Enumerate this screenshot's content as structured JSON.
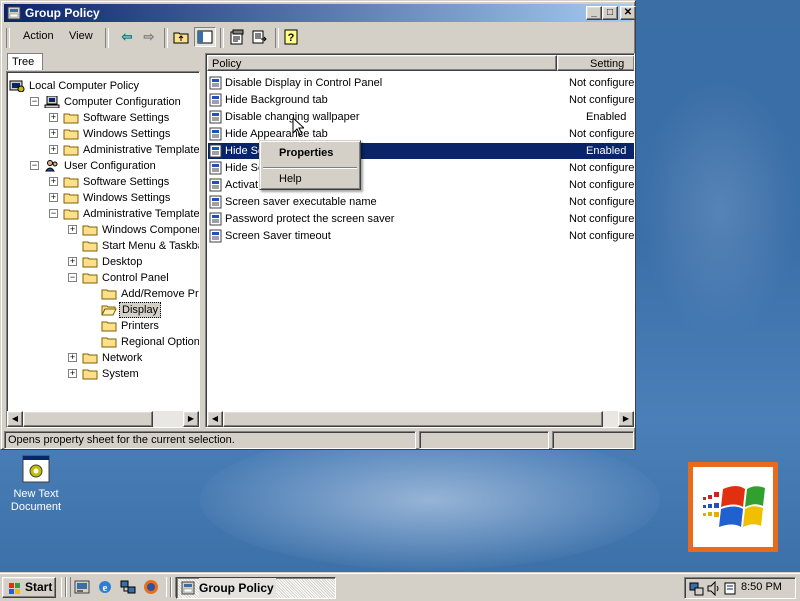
{
  "window": {
    "title": "Group Policy",
    "minimize_glyph": "_",
    "maximize_glyph": "□",
    "close_glyph": "✕"
  },
  "menu": {
    "action": "Action",
    "view": "View"
  },
  "toolbar": {
    "back_glyph": "⇦",
    "forward_glyph": "⇨"
  },
  "tree": {
    "tab_label": "Tree",
    "items": [
      {
        "label": "Local Computer Policy",
        "icon": "computer-policy-icon"
      },
      {
        "label": "Computer Configuration",
        "icon": "computer-icon",
        "expander": "−"
      },
      {
        "label": "Software Settings",
        "icon": "folder-icon",
        "expander": "+"
      },
      {
        "label": "Windows Settings",
        "icon": "folder-icon",
        "expander": "+"
      },
      {
        "label": "Administrative Templates",
        "icon": "folder-icon",
        "expander": "+"
      },
      {
        "label": "User Configuration",
        "icon": "user-icon",
        "expander": "−"
      },
      {
        "label": "Software Settings",
        "icon": "folder-icon",
        "expander": "+"
      },
      {
        "label": "Windows Settings",
        "icon": "folder-icon",
        "expander": "+"
      },
      {
        "label": "Administrative Templates",
        "icon": "folder-icon",
        "expander": "−"
      },
      {
        "label": "Windows Components",
        "icon": "folder-icon",
        "expander": "+"
      },
      {
        "label": "Start Menu & Taskbar",
        "icon": "folder-icon"
      },
      {
        "label": "Desktop",
        "icon": "folder-icon",
        "expander": "+"
      },
      {
        "label": "Control Panel",
        "icon": "folder-icon",
        "expander": "−"
      },
      {
        "label": "Add/Remove Programs",
        "icon": "folder-icon"
      },
      {
        "label": "Display",
        "icon": "open-folder-icon",
        "selected": true
      },
      {
        "label": "Printers",
        "icon": "folder-icon"
      },
      {
        "label": "Regional Options",
        "icon": "folder-icon"
      },
      {
        "label": "Network",
        "icon": "folder-icon",
        "expander": "+"
      },
      {
        "label": "System",
        "icon": "folder-icon",
        "expander": "+"
      }
    ]
  },
  "policy_list": {
    "columns": {
      "policy": "Policy",
      "setting": "Setting"
    },
    "rows": [
      {
        "name": "Disable Display in Control Panel",
        "setting": "Not configured"
      },
      {
        "name": "Hide Background tab",
        "setting": "Not configured"
      },
      {
        "name": "Disable changing wallpaper",
        "setting": "Enabled"
      },
      {
        "name": "Hide Appearance tab",
        "setting": "Not configured"
      },
      {
        "name": "Hide Se",
        "setting": "Enabled",
        "selected": true
      },
      {
        "name": "Hide Sc",
        "setting": "Not configured"
      },
      {
        "name": "Activat",
        "setting": "Not configured"
      },
      {
        "name": "Screen saver executable name",
        "setting": "Not configured"
      },
      {
        "name": "Password protect the screen saver",
        "setting": "Not configured"
      },
      {
        "name": "Screen Saver timeout",
        "setting": "Not configured"
      }
    ]
  },
  "context_menu": {
    "properties": "Properties",
    "help": "Help"
  },
  "statusbar": {
    "text": "Opens property sheet for the current selection."
  },
  "desktop": {
    "icon_label_line1": "New Text",
    "icon_label_line2": "Document"
  },
  "taskbar": {
    "start": "Start",
    "task_button": "Group Policy",
    "clock": "8:50 PM"
  },
  "colors": {
    "selection": "#0a246a",
    "desktop": "#3a6ea5",
    "face": "#d4d0c8"
  }
}
